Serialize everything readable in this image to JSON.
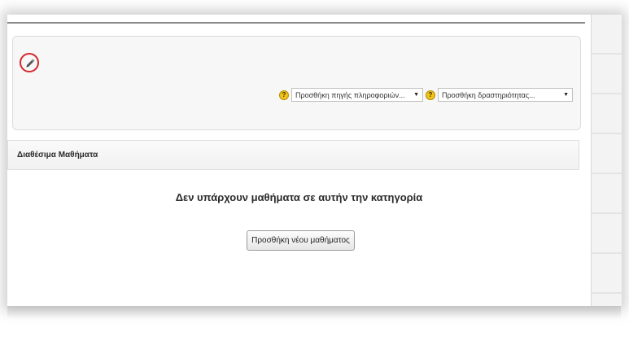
{
  "page": {
    "section_title": "Διαθέσιμα Μαθήματα",
    "empty_message": "Δεν υπάρχουν μαθήματα σε αυτήν την κατηγορία",
    "add_course_label": "Προσθήκη νέου μαθήματος"
  },
  "toolbar": {
    "edit_icon": "edit-icon",
    "help_glyph": "?",
    "add_resource": "Προσθήκη πηγής πληροφοριών...",
    "add_activity": "Προσθήκη δραστηριότητας...",
    "caret_glyph": "▼"
  },
  "colors": {
    "highlight_ring": "#d4272d",
    "help_icon": "#f0c419"
  }
}
